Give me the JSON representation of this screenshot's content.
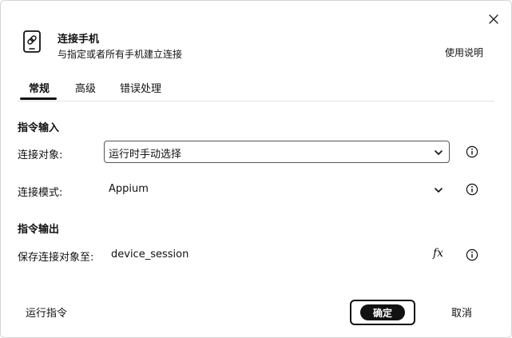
{
  "header": {
    "title": "连接手机",
    "subtitle": "与指定或者所有手机建立连接",
    "help_label": "使用说明",
    "icon": "link-phone-icon"
  },
  "tabs": [
    {
      "label": "常规",
      "active": true
    },
    {
      "label": "高级",
      "active": false
    },
    {
      "label": "错误处理",
      "active": false
    }
  ],
  "input_section": {
    "title": "指令输入",
    "connect_target": {
      "label": "连接对象:",
      "value": "运行时手动选择"
    },
    "connect_mode": {
      "label": "连接模式:",
      "value": "Appium"
    }
  },
  "output_section": {
    "title": "指令输出",
    "save_to": {
      "label": "保存连接对象至:",
      "value": "device_session",
      "fx_label": "fx"
    }
  },
  "footer": {
    "run_label": "运行指令",
    "ok_label": "确定",
    "cancel_label": "取消"
  }
}
